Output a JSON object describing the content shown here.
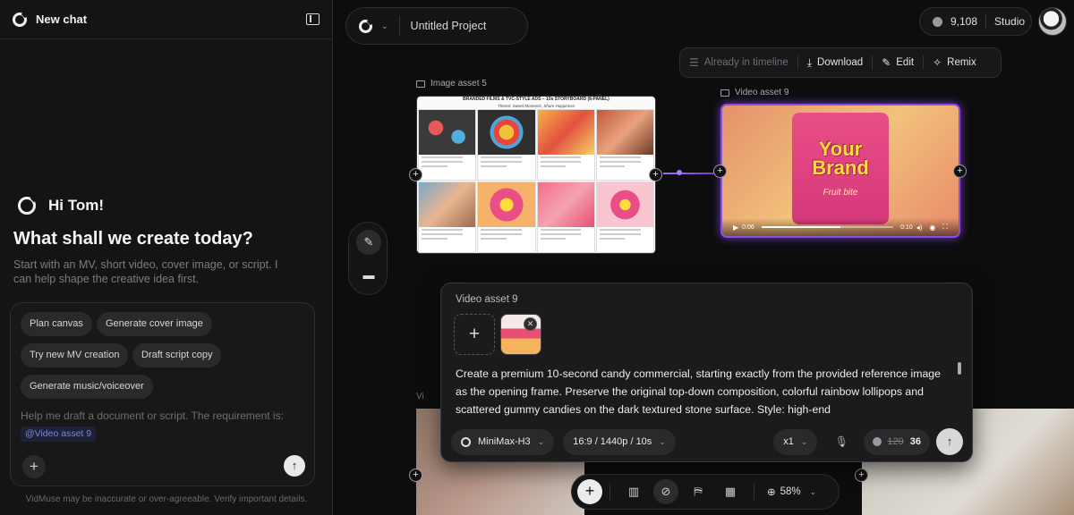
{
  "sidebar": {
    "new_chat": "New chat",
    "greeting": "Hi Tom!",
    "headline": "What shall we create today?",
    "subtext": "Start with an MV, short video, cover image, or script. I can help shape the creative idea first.",
    "chips": [
      "Plan canvas",
      "Generate cover image",
      "Try new MV creation",
      "Draft script copy",
      "Generate music/voiceover"
    ],
    "prompt_placeholder": "Help me draft a document or script. The requirement is:",
    "mention": "@Video asset 9",
    "disclaimer": "VidMuse may be inaccurate or over-agreeable. Verify important details."
  },
  "header": {
    "project_name": "Untitled Project",
    "credits": "9,108",
    "plan": "Studio"
  },
  "asset_toolbar": {
    "already": "Already in timeline",
    "download": "Download",
    "edit": "Edit",
    "remix": "Remix"
  },
  "canvas": {
    "image_asset_label": "Image asset 5",
    "video_asset_label": "Video asset 9",
    "storyboard_title": "BRANDED FILMS & TVC-STYLE ADS – 10s STORYBOARD (8-PANEL)",
    "storyboard_subtitle": "Theme: Sweet Moments, Share Happiness",
    "video": {
      "brand_line1": "Your",
      "brand_line2": "Brand",
      "brand_sub": "Fruit bite",
      "current_time": "0:06",
      "duration": "0:10",
      "progress": 0.6
    },
    "bg_label": "Vi"
  },
  "edit_panel": {
    "title": "Video asset 9",
    "prompt": "Create a premium 10-second candy commercial, starting exactly from the provided reference image as the opening frame. Preserve the original top-down composition, colorful rainbow lollipops and scattered gummy candies on the dark textured stone surface. Style: high-end",
    "model": "MiniMax-H3",
    "format": "16:9 / 1440p / 10s",
    "multiplier": "x1",
    "cost_old": "120",
    "cost_new": "36"
  },
  "bottom_toolbar": {
    "zoom": "58%"
  }
}
